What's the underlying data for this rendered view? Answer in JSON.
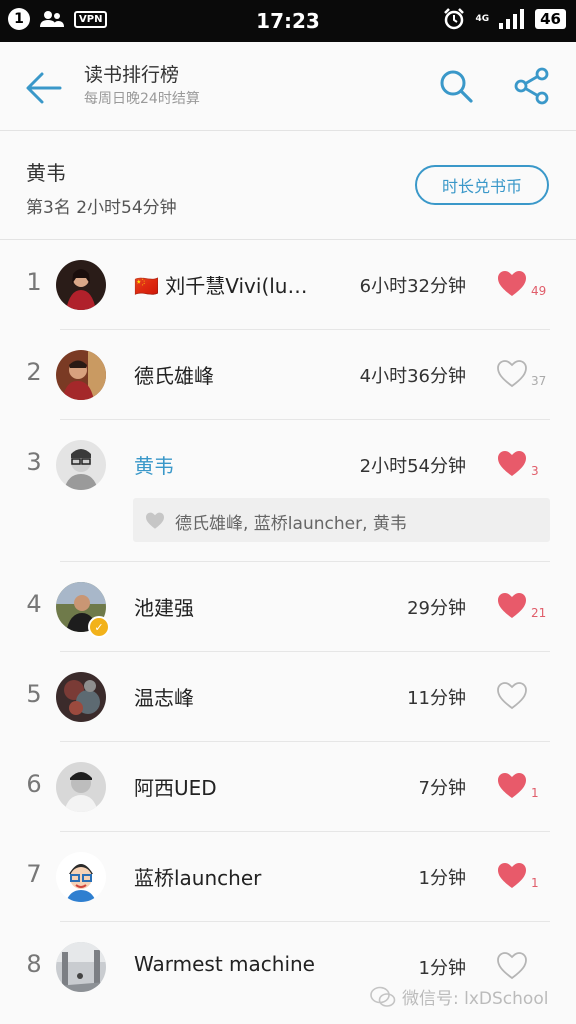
{
  "status_bar": {
    "notification_count": "1",
    "vpn": "VPN",
    "time": "17:23",
    "network": "4G",
    "battery": "46"
  },
  "header": {
    "title": "读书排行榜",
    "subtitle": "每周日晚24时结算"
  },
  "me": {
    "name": "黄韦",
    "rank_text": "第3名  2小时54分钟",
    "redeem_label": "时长兑书币"
  },
  "list": [
    {
      "rank": "1",
      "name": "🇨🇳 刘千慧Vivi(lu…",
      "duration": "6小时32分钟",
      "liked": true,
      "likes": "49"
    },
    {
      "rank": "2",
      "name": "德氏雄峰",
      "duration": "4小时36分钟",
      "liked": false,
      "likes": "37"
    },
    {
      "rank": "3",
      "name": "黄韦",
      "duration": "2小时54分钟",
      "liked": true,
      "likes": "3"
    },
    {
      "rank": "4",
      "name": "池建强",
      "duration": "29分钟",
      "liked": true,
      "likes": "21"
    },
    {
      "rank": "5",
      "name": "温志峰",
      "duration": "11分钟",
      "liked": false,
      "likes": ""
    },
    {
      "rank": "6",
      "name": "阿西UED",
      "duration": "7分钟",
      "liked": true,
      "likes": "1"
    },
    {
      "rank": "7",
      "name": "蓝桥launcher",
      "duration": "1分钟",
      "liked": true,
      "likes": "1"
    },
    {
      "rank": "8",
      "name": "Warmest machine",
      "duration": "1分钟",
      "liked": false,
      "likes": ""
    }
  ],
  "liked_by": "德氏雄峰, 蓝桥launcher, 黄韦",
  "watermark": "微信号: lxDSchool",
  "colors": {
    "accent": "#3a98c9",
    "heart": "#e85a6a",
    "heart_empty": "#b5b5b5"
  }
}
